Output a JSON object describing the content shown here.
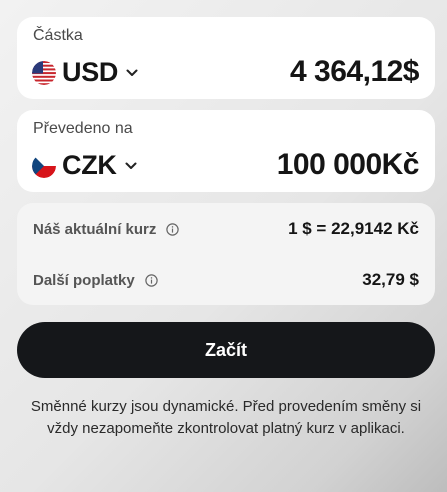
{
  "from": {
    "label": "Částka",
    "currency": "USD",
    "flag_icon": "us-flag-icon",
    "amount": "4 364,12$"
  },
  "to": {
    "label": "Převedeno na",
    "currency": "CZK",
    "flag_icon": "cz-flag-icon",
    "amount": "100 000Kč"
  },
  "info": {
    "rate_label": "Náš aktuální kurz",
    "rate_value": "1 $ = 22,9142 Kč",
    "fees_label": "Další poplatky",
    "fees_value": "32,79 $"
  },
  "actions": {
    "start_label": "Začít"
  },
  "disclaimer": "Směnné kurzy jsou dynamické. Před provedením směny si vždy nezapomeňte zkontrolovat platný kurz v aplikaci.",
  "colors": {
    "button_bg": "#15171a",
    "card_bg": "#ffffff",
    "info_card_bg": "#f4f4f4"
  }
}
